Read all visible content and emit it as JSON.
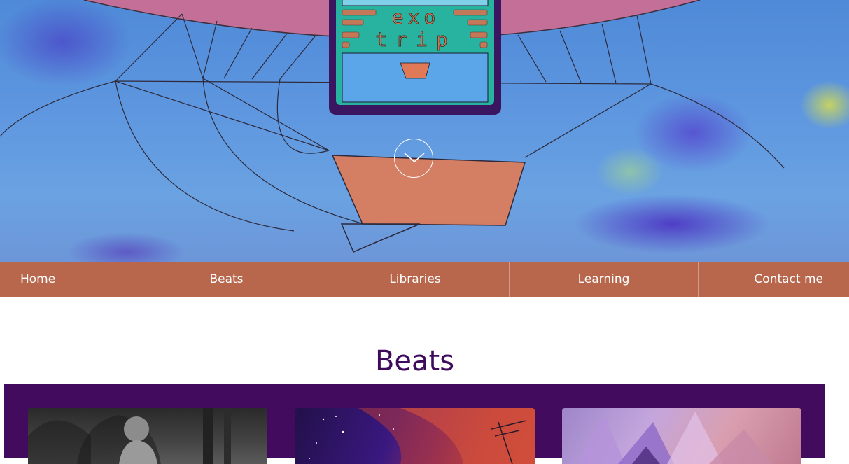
{
  "hero": {
    "logo_line1": "exo",
    "logo_line2": "trip",
    "scroll_button_icon": "chevron-down-icon"
  },
  "nav": {
    "items": [
      {
        "label": "Home"
      },
      {
        "label": "Beats"
      },
      {
        "label": "Libraries"
      },
      {
        "label": "Learning"
      },
      {
        "label": "Contact me"
      }
    ]
  },
  "section": {
    "title": "Beats"
  },
  "colors": {
    "nav_bg": "#b8674d",
    "title": "#3e0b5c",
    "panel_bg": "#430b5e"
  }
}
